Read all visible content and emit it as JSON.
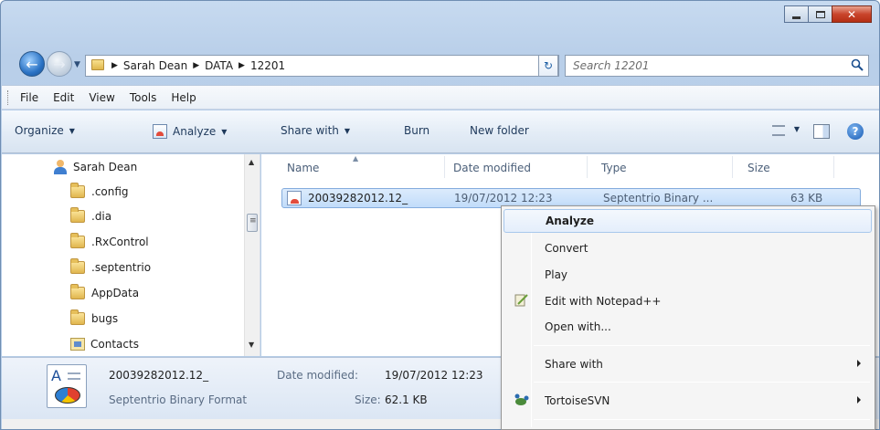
{
  "window": {
    "caption_buttons": [
      "minimize",
      "maximize",
      "close"
    ]
  },
  "nav": {
    "breadcrumbs": [
      "Sarah Dean",
      "DATA",
      "12201"
    ],
    "search_placeholder": "Search 12201"
  },
  "menubar": {
    "items": [
      "File",
      "Edit",
      "View",
      "Tools",
      "Help"
    ]
  },
  "toolbar": {
    "organize": "Organize",
    "analyze": "Analyze",
    "share_with": "Share with",
    "burn": "Burn",
    "new_folder": "New folder"
  },
  "tree": {
    "items": [
      {
        "label": "Sarah Dean",
        "icon": "user-folder-icon"
      },
      {
        "label": ".config",
        "icon": "folder-icon"
      },
      {
        "label": ".dia",
        "icon": "folder-icon"
      },
      {
        "label": ".RxControl",
        "icon": "folder-icon"
      },
      {
        "label": ".septentrio",
        "icon": "folder-icon"
      },
      {
        "label": "AppData",
        "icon": "folder-icon"
      },
      {
        "label": "bugs",
        "icon": "folder-icon"
      },
      {
        "label": "Contacts",
        "icon": "contacts-folder-icon"
      }
    ]
  },
  "files": {
    "columns": [
      "Name",
      "Date modified",
      "Type",
      "Size"
    ],
    "rows": [
      {
        "name": "20039282012.12_",
        "date": "19/07/2012 12:23",
        "type": "Septentrio Binary ...",
        "size": "63 KB"
      }
    ]
  },
  "details": {
    "filename": "20039282012.12_",
    "filetype": "Septentrio Binary Format",
    "date_label": "Date modified:",
    "date_value": "19/07/2012 12:23",
    "size_label": "Size:",
    "size_value": "62.1 KB"
  },
  "context_menu": {
    "analyze": "Analyze",
    "convert": "Convert",
    "play": "Play",
    "edit_npp": "Edit with Notepad++",
    "open_with": "Open with...",
    "share_with": "Share with",
    "tortoise": "TortoiseSVN"
  },
  "colors": {
    "accent": "#3a6fb0",
    "selection": "#c1dcfa"
  }
}
